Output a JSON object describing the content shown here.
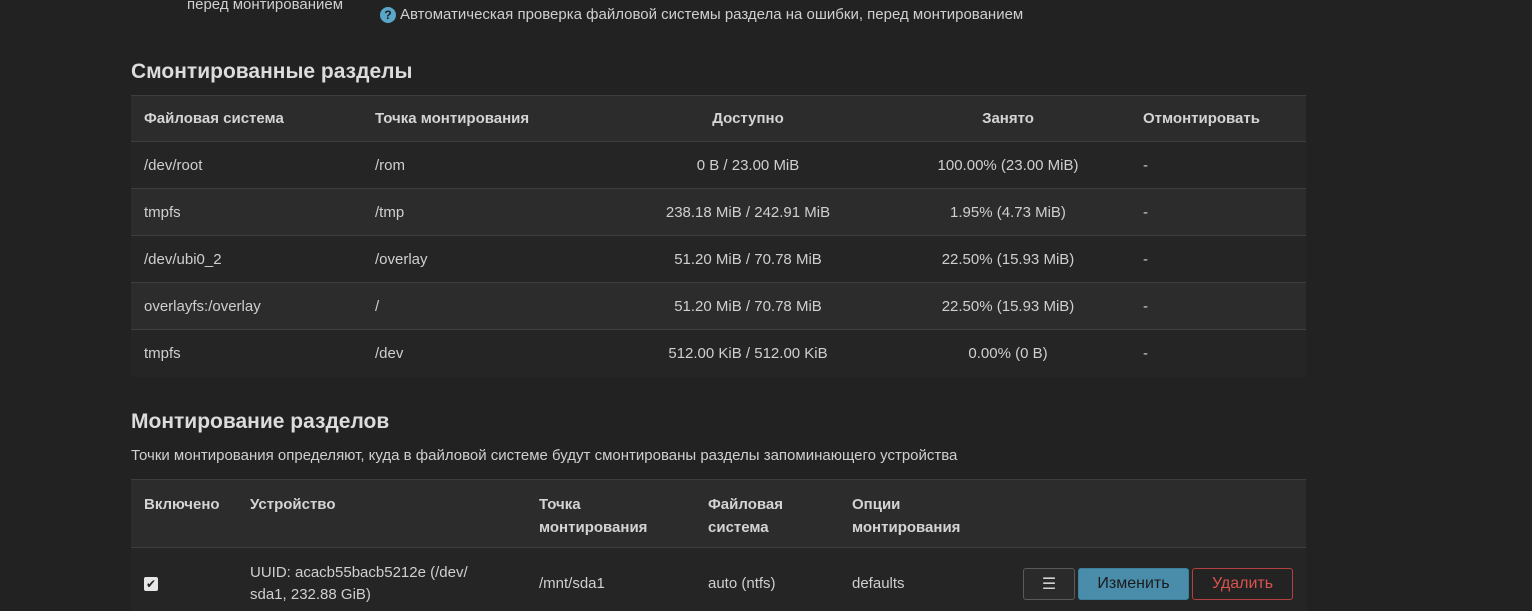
{
  "previous_field": {
    "label": "перед монтированием",
    "help_icon": "question-circle-icon",
    "help_text": "Автоматическая проверка файловой системы раздела на ошибки, перед монтированием"
  },
  "mounted": {
    "title": "Смонтированные разделы",
    "columns": [
      "Файловая система",
      "Точка монтирования",
      "Доступно",
      "Занято",
      "Отмонтировать"
    ],
    "rows": [
      {
        "fs": "/dev/root",
        "mount": "/rom",
        "available": "0 B / 23.00 MiB",
        "used": "100.00% (23.00 MiB)",
        "unmount": "-"
      },
      {
        "fs": "tmpfs",
        "mount": "/tmp",
        "available": "238.18 MiB / 242.91 MiB",
        "used": "1.95% (4.73 MiB)",
        "unmount": "-"
      },
      {
        "fs": "/dev/ubi0_2",
        "mount": "/overlay",
        "available": "51.20 MiB / 70.78 MiB",
        "used": "22.50% (15.93 MiB)",
        "unmount": "-"
      },
      {
        "fs": "overlayfs:/overlay",
        "mount": "/",
        "available": "51.20 MiB / 70.78 MiB",
        "used": "22.50% (15.93 MiB)",
        "unmount": "-"
      },
      {
        "fs": "tmpfs",
        "mount": "/dev",
        "available": "512.00 KiB / 512.00 KiB",
        "used": "0.00% (0 B)",
        "unmount": "-"
      }
    ]
  },
  "mounts": {
    "title": "Монтирование разделов",
    "description": "Точки монтирования определяют, куда в файловой системе будут смонтированы разделы запоминающего устройства",
    "columns": {
      "enabled": "Включено",
      "device": "Устройство",
      "mount_point_1": "Точка",
      "mount_point_2": "монтирования",
      "filesystem_1": "Файловая",
      "filesystem_2": "система",
      "options_1": "Опции",
      "options_2": "монтирования"
    },
    "rows": [
      {
        "enabled": true,
        "enabled_glyph": "✔",
        "device_line1": "UUID: acacb55bacb5212e (/dev/",
        "device_line2": "sda1, 232.88 GiB)",
        "mount_point": "/mnt/sda1",
        "filesystem": "auto (ntfs)",
        "options": "defaults",
        "menu_glyph": "☰",
        "edit_label": "Изменить",
        "delete_label": "Удалить"
      }
    ]
  }
}
